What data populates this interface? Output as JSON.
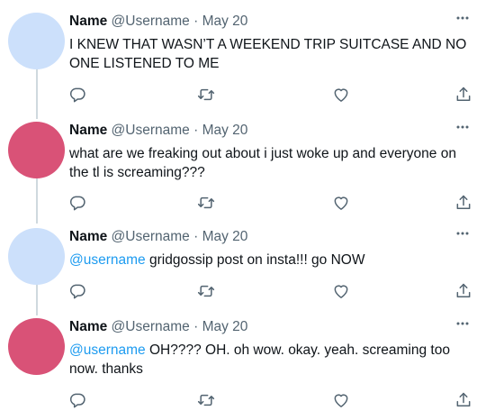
{
  "tweets": [
    {
      "name": "Name",
      "handle": "@Username",
      "sep": "·",
      "date": "May 20",
      "mention": "",
      "text": "I KNEW THAT WASN’T A WEEKEND TRIP SUITCASE AND NO ONE LISTENED TO ME",
      "avatar_color": "#cce0fb"
    },
    {
      "name": "Name",
      "handle": "@Username",
      "sep": "·",
      "date": "May 20",
      "mention": "",
      "text": "what are we freaking out about i just woke up and everyone on the tl is screaming???",
      "avatar_color": "#d95277"
    },
    {
      "name": "Name",
      "handle": "@Username",
      "sep": "·",
      "date": "May 20",
      "mention": "@username",
      "text": " gridgossip post on insta!!! go NOW",
      "avatar_color": "#cce0fb"
    },
    {
      "name": "Name",
      "handle": "@Username",
      "sep": "·",
      "date": "May 20",
      "mention": "@username",
      "text": " OH???? OH. oh wow. okay. yeah. screaming too now. thanks",
      "avatar_color": "#d95277"
    }
  ],
  "icons": {
    "more": "more-icon",
    "reply": "reply-icon",
    "retweet": "retweet-icon",
    "like": "like-icon",
    "share": "share-icon"
  },
  "colors": {
    "icon": "#536471",
    "mention": "#1d9bf0",
    "thread_line": "#cfd9de"
  }
}
